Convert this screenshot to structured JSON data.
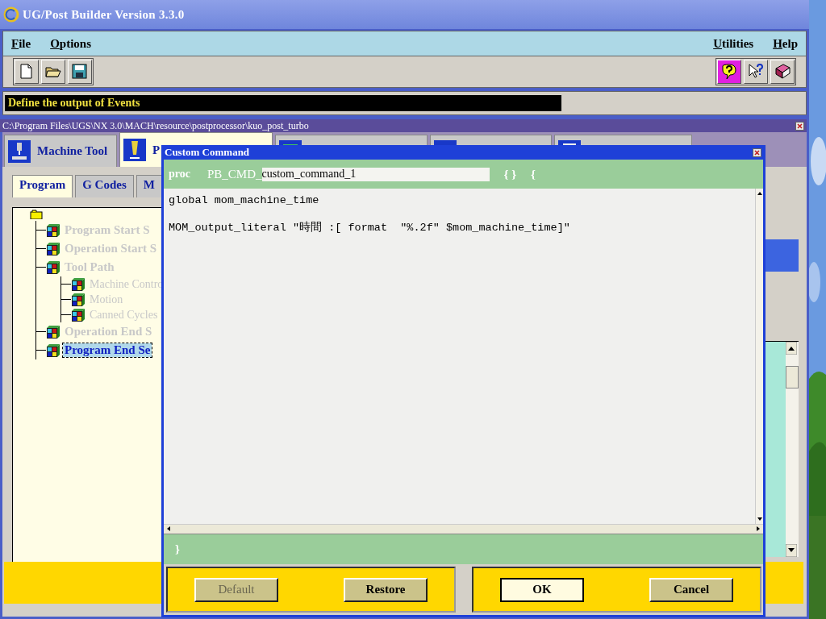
{
  "window": {
    "title": "UG/Post Builder Version 3.3.0"
  },
  "menu": {
    "left": [
      "File",
      "Options"
    ],
    "right": [
      "Utilities",
      "Help"
    ]
  },
  "status_message": "Define the output of Events",
  "path_bar": {
    "path": "C:\\Program Files\\UGS\\NX 3.0\\MACH\\resource\\postprocessor\\kuo_post_turbo"
  },
  "tabs": [
    {
      "label": "Machine Tool",
      "selected": false
    },
    {
      "label": "P",
      "selected": true
    },
    {
      "selected": false
    },
    {
      "selected": false
    },
    {
      "selected": false
    }
  ],
  "subtabs": [
    {
      "label": "Program",
      "selected": true
    },
    {
      "label": "G Codes",
      "selected": false
    },
    {
      "label": "M",
      "selected": false
    }
  ],
  "tree": {
    "children": [
      {
        "label": "Program Start S",
        "disabled": true,
        "selected": false
      },
      {
        "label": "Operation Start S",
        "disabled": true,
        "selected": false
      },
      {
        "label": "Tool Path",
        "disabled": true,
        "selected": false,
        "children": [
          {
            "label": "Machine Contro",
            "disabled": true,
            "selected": false
          },
          {
            "label": "Motion",
            "disabled": true,
            "selected": false
          },
          {
            "label": "Canned Cycles",
            "disabled": true,
            "selected": false
          }
        ]
      },
      {
        "label": "Operation End S",
        "disabled": true,
        "selected": false
      },
      {
        "label": "Program End Se",
        "disabled": false,
        "selected": true
      }
    ]
  },
  "dialog": {
    "title": "Custom Command",
    "proc_label": "proc",
    "name_prefix": "PB_CMD_",
    "name_value": "custom_command_1",
    "args": "{ }",
    "open_brace": "{",
    "code_lines": [
      "global mom_machine_time",
      "MOM_output_literal \"時間 :[ format  \"%.2f\" $mom_machine_time]\""
    ],
    "close_brace": "}",
    "button_groups": [
      [
        {
          "label": "Default",
          "disabled": true,
          "focused": false
        },
        {
          "label": "Restore",
          "disabled": false,
          "focused": false
        }
      ],
      [
        {
          "label": "OK",
          "disabled": false,
          "focused": true
        },
        {
          "label": "Cancel",
          "disabled": false,
          "focused": false
        }
      ]
    ]
  }
}
